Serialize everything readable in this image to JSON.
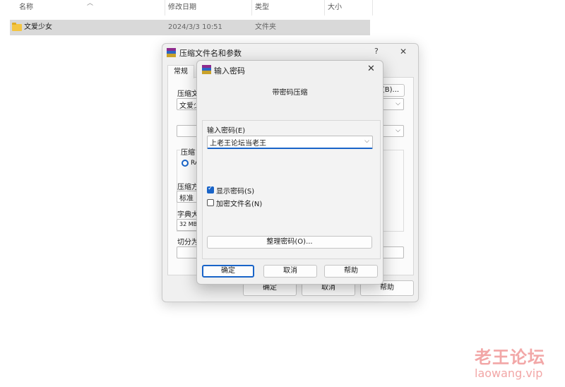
{
  "explorer": {
    "columns": [
      "名称",
      "修改日期",
      "类型",
      "大小"
    ],
    "row": {
      "name": "文爱少女",
      "modified": "2024/3/3 10:51",
      "type": "文件夹",
      "size": ""
    }
  },
  "archive_dialog": {
    "title": "压缩文件名和参数",
    "help_glyph": "?",
    "close_glyph": "✕",
    "tab_general": "常规",
    "archive_name_label": "压缩文",
    "archive_name_value": "文爱少",
    "browse_button": "(B)...",
    "format_group_label": "压缩",
    "format_rar_label": "RA",
    "method_label": "压缩方",
    "method_value": "标准",
    "dict_label": "字典大",
    "dict_value": "32 MB",
    "split_label": "切分为",
    "ok_button": "确定",
    "cancel_button": "取消",
    "help_button": "帮助"
  },
  "password_dialog": {
    "title": "输入密码",
    "close_glyph": "✕",
    "heading": "带密码压缩",
    "password_label": "输入密码(E)",
    "password_value": "上老王论坛当老王",
    "show_password_label": "显示密码(S)",
    "show_password_checked": true,
    "encrypt_names_label": "加密文件名(N)",
    "encrypt_names_checked": false,
    "organize_button": "整理密码(O)...",
    "ok_button": "确定",
    "cancel_button": "取消",
    "help_button": "帮助"
  },
  "watermark": {
    "cn": "老王论坛",
    "en": "laowang.vip"
  },
  "colors": {
    "accent": "#1964c8",
    "dialog_bg": "#f0f0f0",
    "selected_row": "#d9d9d9",
    "watermark": "#f2a7a7"
  }
}
